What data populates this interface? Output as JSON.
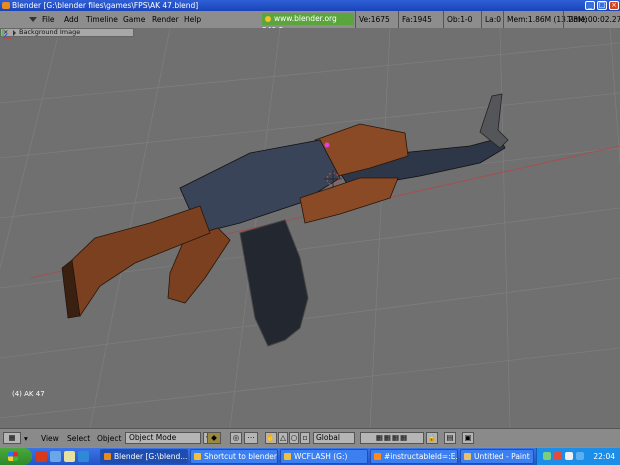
{
  "window": {
    "title": "Blender [G:\\blender files\\games\\FPS\\AK 47.blend]"
  },
  "menu": {
    "items": [
      "File",
      "Add",
      "Timeline",
      "Game",
      "Render",
      "Help"
    ],
    "logo": "www.blender.org 249.2",
    "stats": {
      "verts": "Ve:1675",
      "faces": "Fa:1945",
      "objects": "Ob:1-0",
      "lamps": "La:0",
      "memory": "Mem:1.86M (13.28M)",
      "time": "Time:00:02.27"
    }
  },
  "background_panel": {
    "label": "Background Image",
    "close": "×"
  },
  "viewport": {
    "object_label": "(4) AK 47"
  },
  "footer": {
    "menus": [
      "View",
      "Select",
      "Object"
    ],
    "mode": "Object Mode",
    "orientation": "Global"
  },
  "taskbar": {
    "start": "start",
    "tasks": [
      {
        "label": "Blender [G:\\blend...",
        "active": true
      },
      {
        "label": "Shortcut to blender",
        "active": false
      },
      {
        "label": "WCFLASH (G:)",
        "active": false
      },
      {
        "label": "#instructableId=:E...",
        "active": false
      },
      {
        "label": "Untitled - Paint",
        "active": false
      }
    ],
    "clock": "22:04"
  },
  "colors": {
    "viewport_bg": "#707070",
    "menubar": "#8d8d8d",
    "taskbar": "#2453c8",
    "logo_green": "#5aa53c"
  }
}
